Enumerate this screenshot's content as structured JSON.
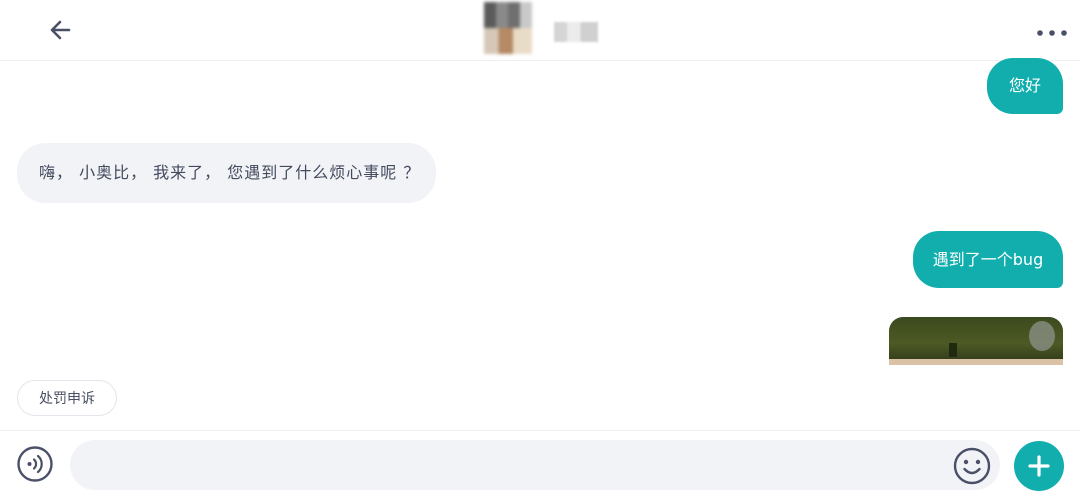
{
  "header": {
    "back_icon": "arrow-left-icon",
    "contact_name": "",
    "more_icon": "ellipsis-icon"
  },
  "messages": [
    {
      "side": "sent",
      "text": "您好"
    },
    {
      "side": "received",
      "text": "嗨，  小奥比，  我来了，  您遇到了什么烦心事呢  ？"
    },
    {
      "side": "sent",
      "text": "遇到了一个bug"
    },
    {
      "side": "sent",
      "type": "image"
    }
  ],
  "quick_reply": {
    "label": "处罚申诉"
  },
  "input_bar": {
    "voice_icon": "voice-icon",
    "text_value": "",
    "emoji_icon": "smiley-icon",
    "plus_icon": "plus-icon"
  },
  "colors": {
    "accent": "#12aeae",
    "received_bubble": "#f1f3f6",
    "received_text": "#434a5e",
    "icon": "#4a5068"
  }
}
